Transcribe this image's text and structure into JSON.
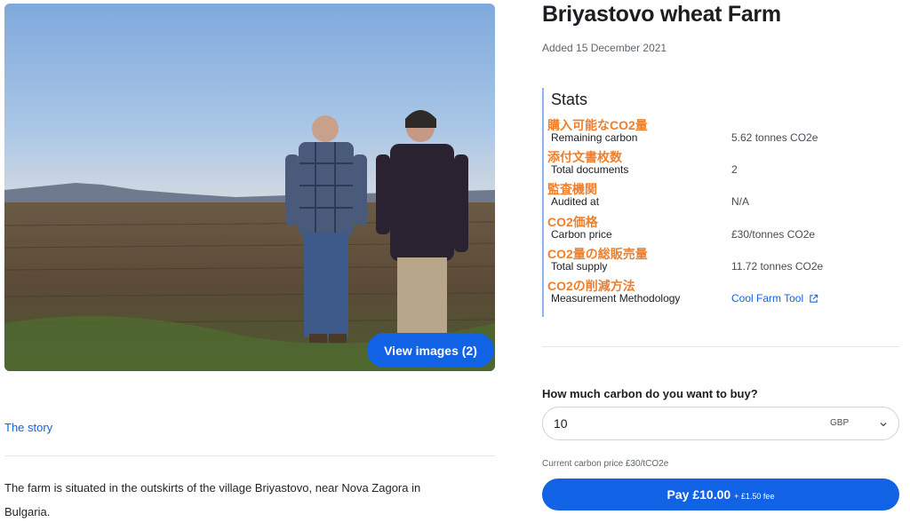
{
  "photo": {
    "view_images_label": "View images (2)"
  },
  "story": {
    "link_label": "The story",
    "text": "The farm is situated in the outskirts of the village Briyastovo, near Nova Zagora in Bulgaria."
  },
  "farm": {
    "title": "Briyastovo wheat Farm",
    "added": "Added 15 December 2021"
  },
  "stats": {
    "heading": "Stats",
    "rows": [
      {
        "jp_label": "購入可能なCO2量",
        "label": "Remaining carbon",
        "value": "5.62 tonnes CO2e"
      },
      {
        "jp_label": "添付文書枚数",
        "label": "Total documents",
        "value": "2"
      },
      {
        "jp_label": "監査機関",
        "label": "Audited at",
        "value": "N/A"
      },
      {
        "jp_label": "CO2価格",
        "label": "Carbon price",
        "value": "£30/tonnes CO2e"
      },
      {
        "jp_label": "CO2量の総販売量",
        "label": "Total supply",
        "value": "11.72 tonnes CO2e"
      },
      {
        "jp_label": "CO2の削減方法",
        "label": "Measurement Methodology",
        "value": "Cool Farm Tool"
      }
    ]
  },
  "purchase": {
    "question": "How much carbon do you want to buy?",
    "amount_value": "10",
    "currency": "GBP",
    "price_note": "Current carbon price £30/tCO2e",
    "pay_label": "Pay £10.00",
    "fee_label": "+ £1.50 fee"
  },
  "icons": {
    "external_link": "external-link-icon",
    "chevron": "chevron-down-icon"
  },
  "colors": {
    "accent": "#1262e6",
    "annotation": "#ef7f2a",
    "stats_border": "#8fb4f0"
  }
}
